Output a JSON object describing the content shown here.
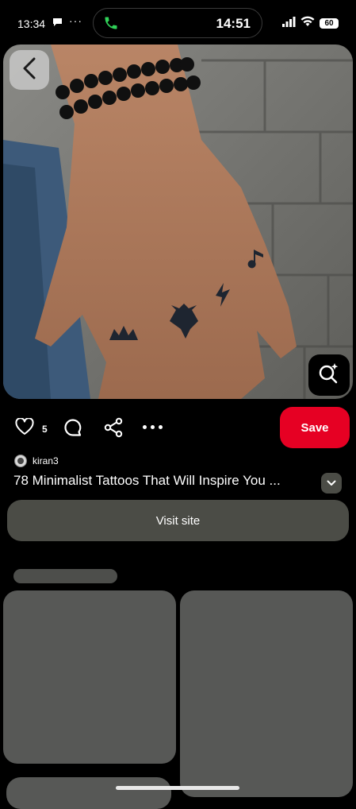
{
  "status_bar": {
    "time": "13:34",
    "more": "···",
    "call_time": "14:51",
    "battery": "60"
  },
  "pin": {
    "likes": "5",
    "creator": "kiran3",
    "title": "78 Minimalist Tattoos That Will Inspire You ...",
    "save_label": "Save",
    "visit_label": "Visit site"
  },
  "colors": {
    "save": "#e60023",
    "button_bg": "#4b4c46",
    "call_icon": "#30d158",
    "skeleton": "#575856"
  },
  "icons": [
    "back-arrow-icon",
    "visual-search-icon",
    "heart-icon",
    "comment-icon",
    "share-icon",
    "more-icon",
    "chevron-down-icon",
    "phone-icon",
    "signal-icon",
    "wifi-icon",
    "battery-icon"
  ]
}
